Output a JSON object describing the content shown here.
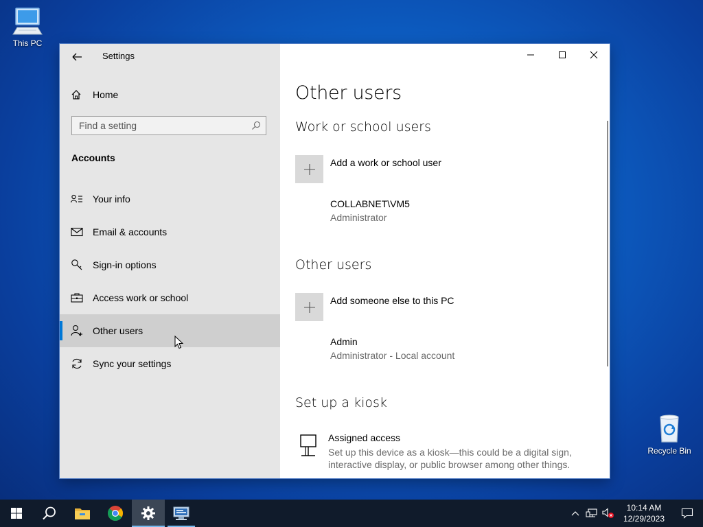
{
  "desktop": {
    "icons": [
      {
        "label": "This PC",
        "icon": "computer-icon"
      },
      {
        "label": "Recycle Bin",
        "icon": "recycle-bin-icon"
      }
    ]
  },
  "window": {
    "title": "Settings",
    "sidebar": {
      "home_label": "Home",
      "search": {
        "placeholder": "Find a setting"
      },
      "section": "Accounts",
      "items": [
        {
          "label": "Your info",
          "icon": "person-card-icon",
          "active": false
        },
        {
          "label": "Email & accounts",
          "icon": "mail-icon",
          "active": false
        },
        {
          "label": "Sign-in options",
          "icon": "key-icon",
          "active": false
        },
        {
          "label": "Access work or school",
          "icon": "briefcase-icon",
          "active": false
        },
        {
          "label": "Other users",
          "icon": "add-person-icon",
          "active": true
        },
        {
          "label": "Sync your settings",
          "icon": "sync-icon",
          "active": false
        }
      ]
    },
    "main": {
      "title": "Other users",
      "work_section": {
        "title": "Work or school users",
        "add_label": "Add a work or school user",
        "users": [
          {
            "name": "COLLABNET\\VM5",
            "role": "Administrator"
          }
        ]
      },
      "other_section": {
        "title": "Other users",
        "add_label": "Add someone else to this PC",
        "users": [
          {
            "name": "Admin",
            "role": "Administrator - Local account"
          }
        ]
      },
      "kiosk_section": {
        "title": "Set up a kiosk",
        "item_title": "Assigned access",
        "item_desc": "Set up this device as a kiosk—this could be a digital sign, interactive display, or public browser among other things."
      }
    }
  },
  "taskbar": {
    "apps": [
      "start-icon",
      "search-icon",
      "file-explorer-icon",
      "chrome-icon",
      "settings-icon",
      "remote-desktop-icon"
    ],
    "clock": {
      "time": "10:14 AM",
      "date": "12/29/2023"
    }
  },
  "colors": {
    "accent": "#0078d7",
    "sidebar_bg": "#e6e6e6",
    "taskbar_bg": "#101b2b"
  }
}
